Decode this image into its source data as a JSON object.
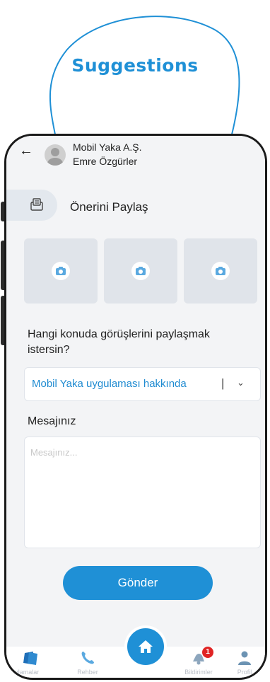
{
  "banner": {
    "title": "Suggestions"
  },
  "header": {
    "company": "Mobil Yaka A.Ş.",
    "user_name": "Emre Özgürler"
  },
  "section": {
    "title": "Önerini Paylaş"
  },
  "photos": [
    {
      "icon": "camera-icon"
    },
    {
      "icon": "camera-icon"
    },
    {
      "icon": "camera-icon"
    }
  ],
  "form": {
    "question": "Hangi konuda görüşlerini paylaşmak istersin?",
    "topic_selected": "Mobil Yaka uygulaması hakkında",
    "message_label": "Mesajınız",
    "message_placeholder": "Mesajınız...",
    "send_label": "Gönder"
  },
  "nav": {
    "items": [
      {
        "label": "Uygulamalar",
        "icon": "apps-icon"
      },
      {
        "label": "Rehber",
        "icon": "phone-icon"
      },
      {
        "label": "Bildirimler",
        "icon": "bell-icon",
        "badge": "1"
      },
      {
        "label": "Profil",
        "icon": "user-icon"
      }
    ],
    "home_icon": "home-icon"
  },
  "colors": {
    "accent": "#1f90d6",
    "badge": "#e02424",
    "screen_bg": "#f3f4f6"
  }
}
